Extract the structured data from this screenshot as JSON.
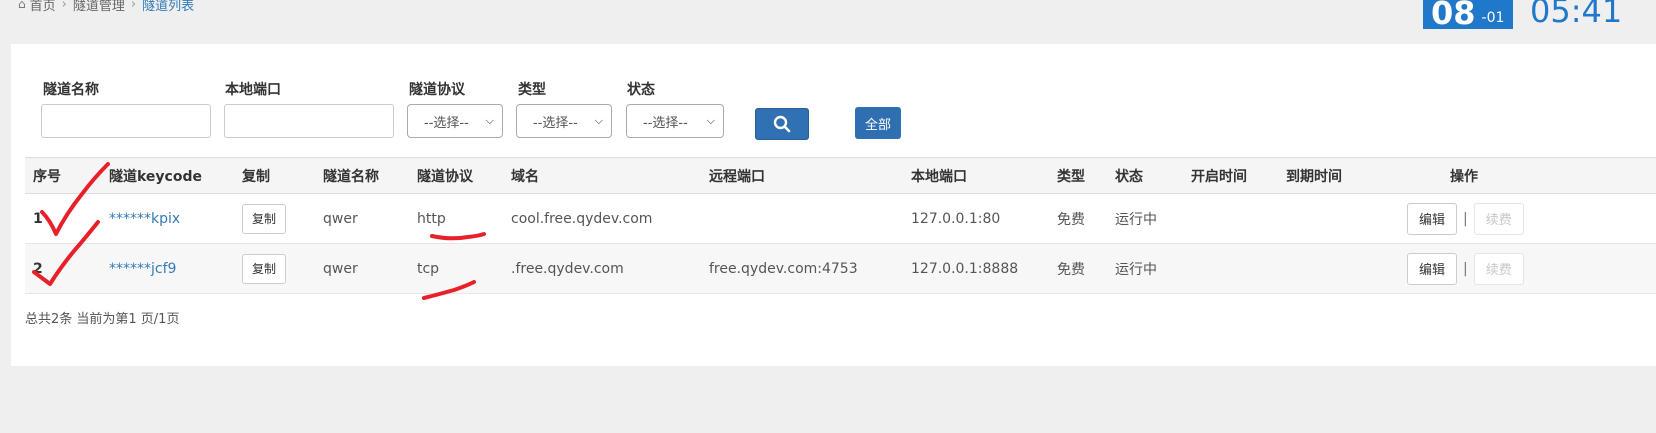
{
  "breadcrumb": {
    "home": "首页",
    "section": "隧道管理",
    "current": "隧道列表"
  },
  "date": {
    "day": "08",
    "month": "-01"
  },
  "clock": "05:41",
  "filters": {
    "name_label": "隧道名称",
    "port_label": "本地端口",
    "protocol_label": "隧道协议",
    "protocol_value": "--选择--",
    "type_label": "类型",
    "type_value": "--选择--",
    "status_label": "状态",
    "status_value": "--选择--",
    "all_label": "全部"
  },
  "table": {
    "headers": [
      "序号",
      "隧道keycode",
      "复制",
      "隧道名称",
      "隧道协议",
      "域名",
      "远程端口",
      "本地端口",
      "类型",
      "状态",
      "开启时间",
      "到期时间",
      "操作"
    ],
    "rows": [
      {
        "idx": "1",
        "keycode": "******kpix",
        "copy": "复制",
        "name": "qwer",
        "protocol": "http",
        "domain": "cool.free.qydev.com",
        "remote_port": "",
        "local_port": "127.0.0.1:80",
        "type": "免费",
        "status": "运行中",
        "start": "",
        "expire": "",
        "edit": "编辑",
        "renew": "续费"
      },
      {
        "idx": "2",
        "keycode": "******jcf9",
        "copy": "复制",
        "name": "qwer",
        "protocol": "tcp",
        "domain": ".free.qydev.com",
        "remote_port": "free.qydev.com:4753",
        "local_port": "127.0.0.1:8888",
        "type": "免费",
        "status": "运行中",
        "start": "",
        "expire": "",
        "edit": "编辑",
        "renew": "续费"
      }
    ]
  },
  "pagination": "总共2条 当前为第1 页/1页",
  "annotation_color": "#e8202a"
}
